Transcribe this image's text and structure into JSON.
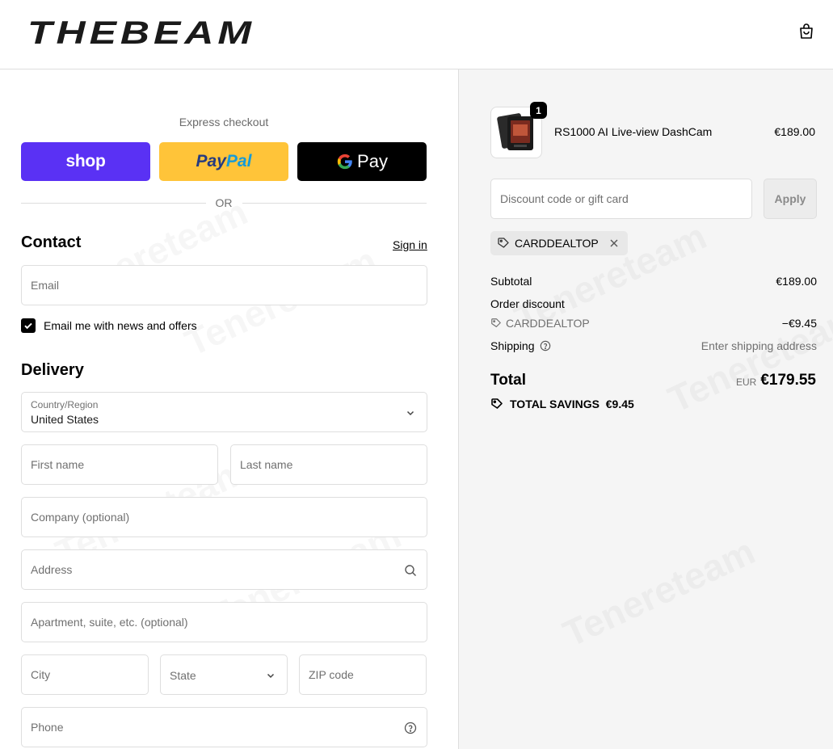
{
  "brand": {
    "name": "THEBEAM"
  },
  "header": {
    "cart_icon": "shopping-bag-icon"
  },
  "express": {
    "title": "Express checkout",
    "shop_label": "shop",
    "paypal_label_1": "Pay",
    "paypal_label_2": "Pal",
    "gpay_label": "Pay",
    "or_label": "OR",
    "colors": {
      "shop": "#5a31f4",
      "paypal": "#ffc439",
      "gpay": "#000000"
    }
  },
  "contact": {
    "title": "Contact",
    "sign_in": "Sign in",
    "email_placeholder": "Email",
    "newsletter_label": "Email me with news and offers",
    "newsletter_checked": true
  },
  "delivery": {
    "title": "Delivery",
    "country_label": "Country/Region",
    "country_value": "United States",
    "first_name_placeholder": "First name",
    "last_name_placeholder": "Last name",
    "company_placeholder": "Company (optional)",
    "address_placeholder": "Address",
    "apartment_placeholder": "Apartment, suite, etc. (optional)",
    "city_placeholder": "City",
    "state_label": "State",
    "zip_placeholder": "ZIP code",
    "phone_placeholder": "Phone"
  },
  "summary": {
    "product": {
      "name": "RS1000 AI Live-view DashCam",
      "price": "€189.00",
      "quantity": "1"
    },
    "discount_placeholder": "Discount code or gift card",
    "apply_label": "Apply",
    "applied_code": "CARDDEALTOP",
    "subtotal_label": "Subtotal",
    "subtotal_value": "€189.00",
    "order_discount_label": "Order discount",
    "discount_code": "CARDDEALTOP",
    "discount_value": "−€9.45",
    "shipping_label": "Shipping",
    "shipping_value": "Enter shipping address",
    "total_label": "Total",
    "total_currency": "EUR",
    "total_value": "€179.55",
    "savings_label": "TOTAL SAVINGS  €9.45"
  },
  "watermark_text": "Tenereteam"
}
